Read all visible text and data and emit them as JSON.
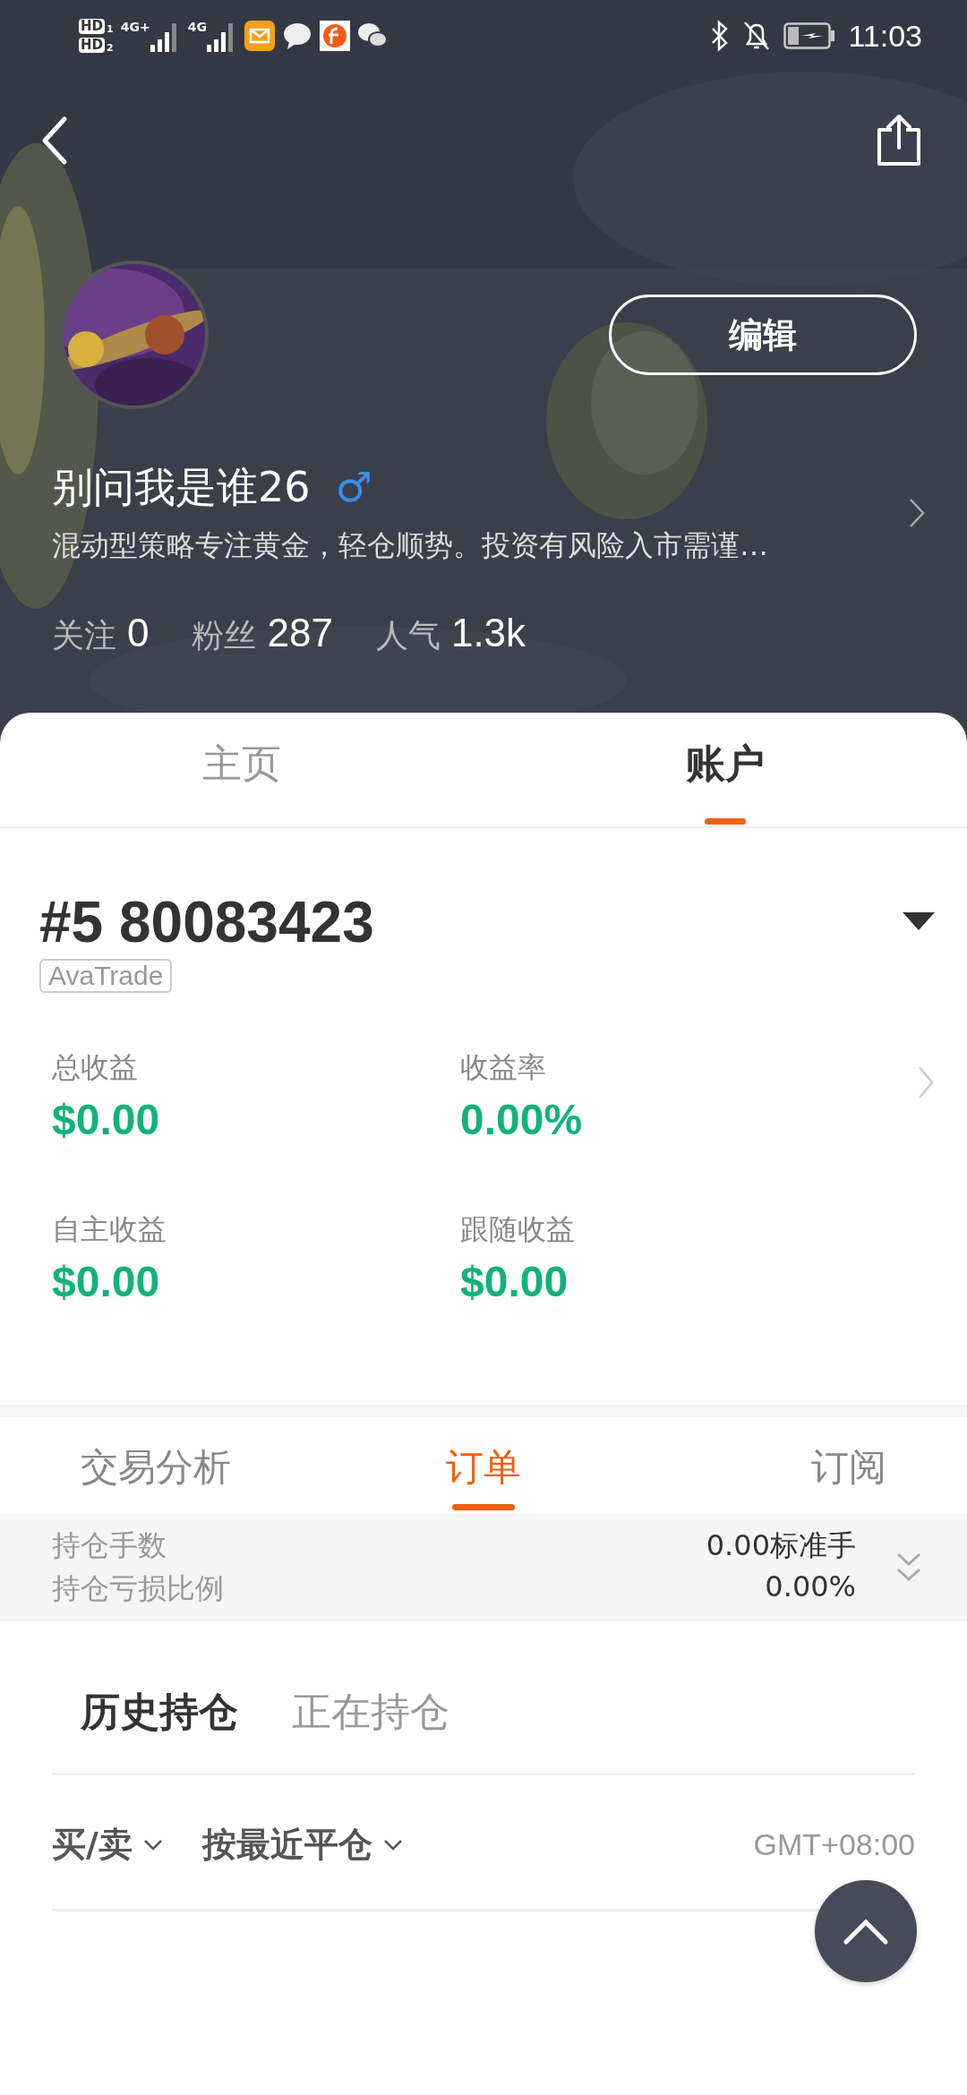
{
  "status_bar": {
    "sims": [
      {
        "label": "HD",
        "index": "1"
      },
      {
        "label": "HD",
        "index": "2"
      }
    ],
    "networks": [
      {
        "label": "4G+"
      },
      {
        "label": "4G"
      }
    ],
    "time": "11:03"
  },
  "profile": {
    "name": "别问我是谁26",
    "gender": "♂",
    "bio": "混动型策略专注黄金，轻仓顺势。投资有风险入市需谨…",
    "edit_button": "编辑",
    "stats": [
      {
        "label": "关注",
        "value": "0"
      },
      {
        "label": "粉丝",
        "value": "287"
      },
      {
        "label": "人气",
        "value": "1.3k"
      }
    ]
  },
  "tabs": [
    {
      "label": "主页",
      "selected": false
    },
    {
      "label": "账户",
      "selected": true
    }
  ],
  "account": {
    "number": "#5 80083423",
    "broker": "AvaTrade",
    "metrics": [
      {
        "label": "总收益",
        "value": "$0.00"
      },
      {
        "label": "收益率",
        "value": "0.00%"
      },
      {
        "label": "自主收益",
        "value": "$0.00"
      },
      {
        "label": "跟随收益",
        "value": "$0.00"
      }
    ]
  },
  "sub_tabs": [
    {
      "label": "交易分析",
      "selected": false
    },
    {
      "label": "订单",
      "selected": true
    },
    {
      "label": "订阅",
      "selected": false
    }
  ],
  "summary": [
    {
      "label": "持仓手数",
      "value": "0.00标准手"
    },
    {
      "label": "持仓亏损比例",
      "value": "0.00%"
    }
  ],
  "position_tabs": [
    {
      "label": "历史持仓",
      "selected": true
    },
    {
      "label": "正在持仓",
      "selected": false
    }
  ],
  "filters": [
    {
      "label": "买/卖"
    },
    {
      "label": "按最近平仓"
    }
  ],
  "timezone": "GMT+08:00"
}
